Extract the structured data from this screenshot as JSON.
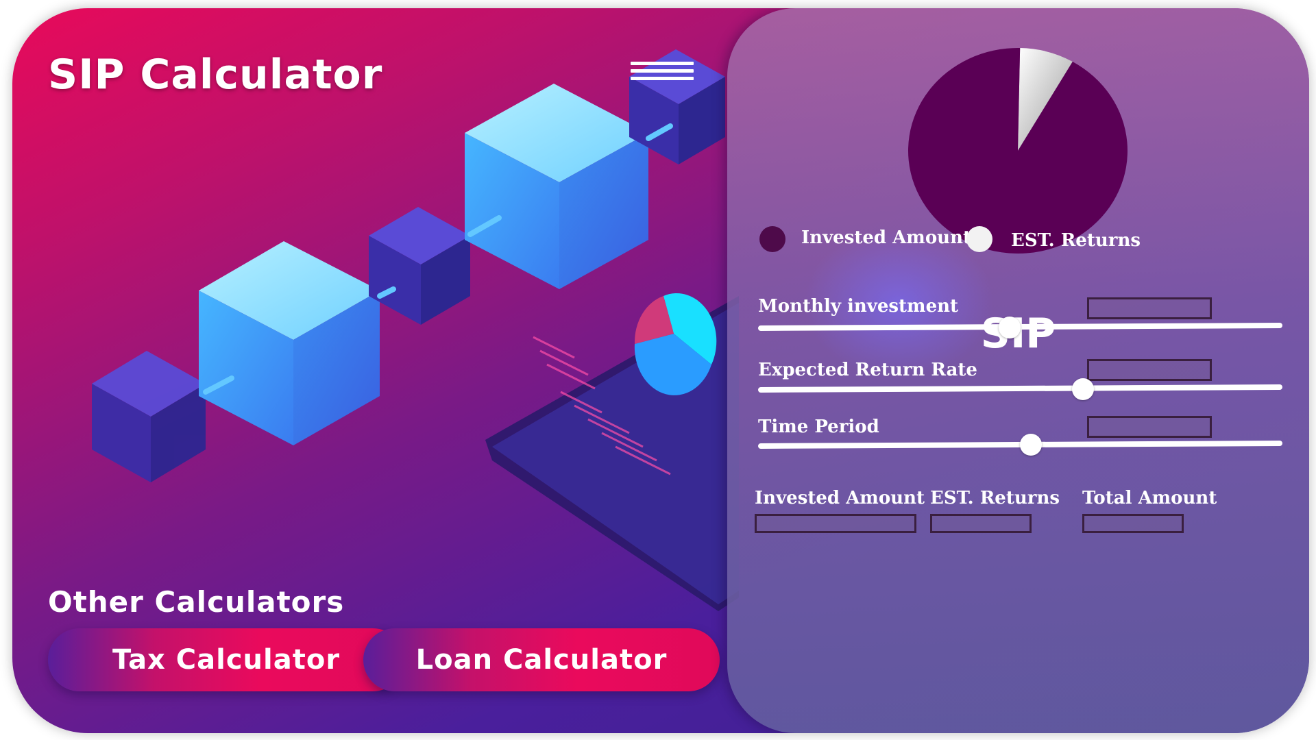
{
  "app": {
    "title": "SIP Calculator"
  },
  "other": {
    "title": "Other Calculators",
    "tax_label": "Tax Calculator",
    "loan_label": "Loan Calculator"
  },
  "panel": {
    "chart_data": {
      "type": "pie",
      "slices": [
        {
          "label": "Invested Amount",
          "value": 0.92,
          "color": "#5a0055"
        },
        {
          "label": "EST. Returns",
          "value": 0.08,
          "color": "#e8e8e8"
        }
      ]
    },
    "legend": {
      "invested": "Invested Amount",
      "returns": "EST. Returns",
      "invested_color": "#4e0a4a",
      "returns_color": "#f2f2f2"
    },
    "heading": "SIP",
    "fields": [
      {
        "label": "Monthly investment",
        "value": "",
        "slider_fraction": 0.48
      },
      {
        "label": "Expected Return Rate",
        "value": "",
        "slider_fraction": 0.62
      },
      {
        "label": "Time Period",
        "value": "",
        "slider_fraction": 0.52
      }
    ],
    "summary": {
      "invested_label": "Invested Amount",
      "returns_label": "EST. Returns",
      "total_label": "Total Amount"
    }
  },
  "icons": {
    "menu": "hamburger-menu-icon"
  }
}
